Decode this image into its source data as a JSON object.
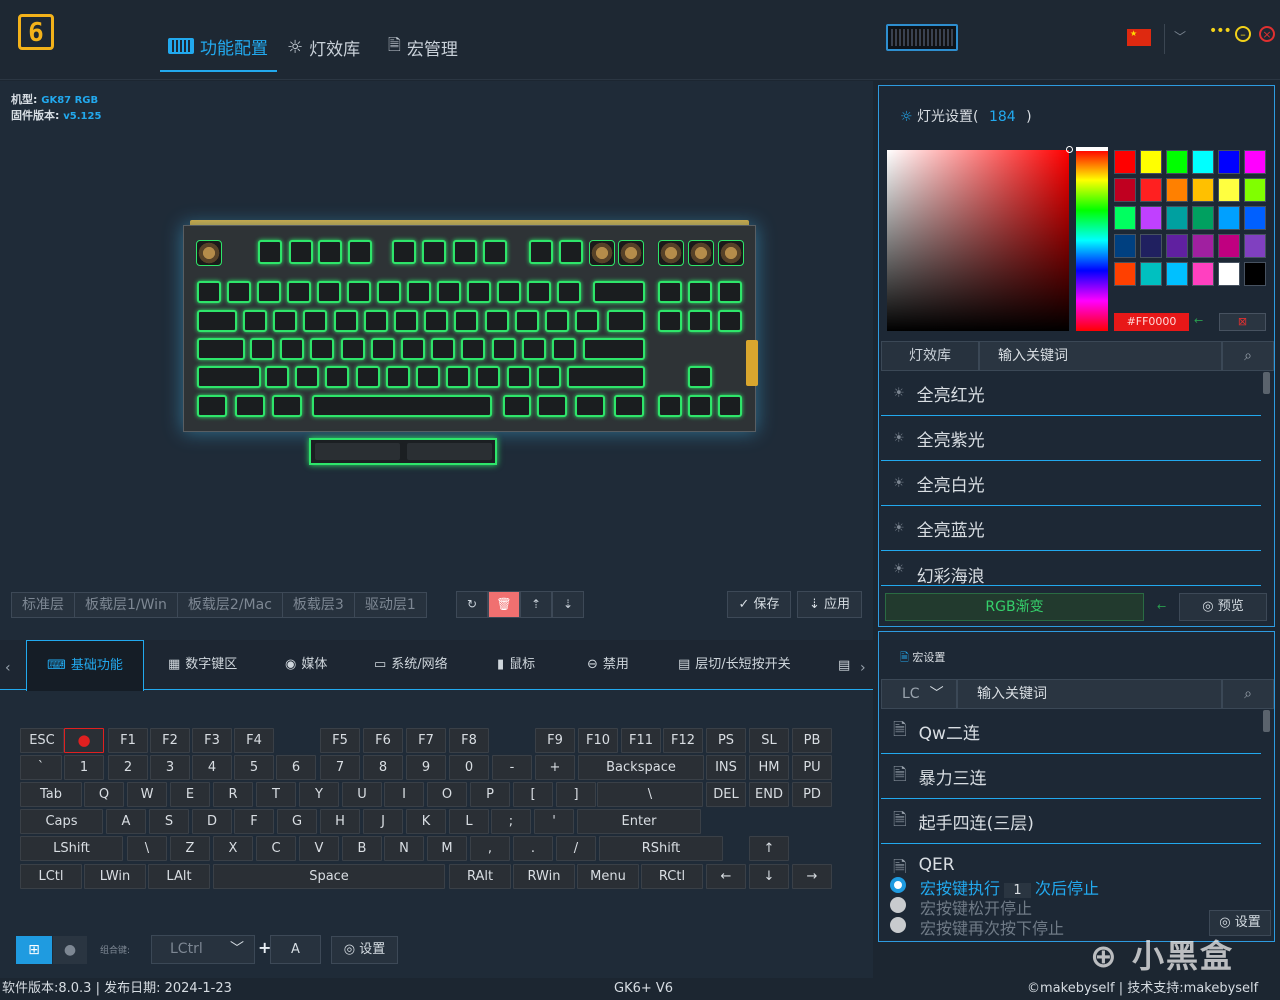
{
  "nav": {
    "tab1": "功能配置",
    "tab2": "灯效库",
    "tab3": "宏管理"
  },
  "device": {
    "model_label": "机型:",
    "model_value": "GK87 RGB",
    "firmware_label": "固件版本:",
    "firmware_value": "v5.125"
  },
  "layers": [
    "标准层",
    "板载层1/Win",
    "板载层2/Mac",
    "板载层3",
    "驱动层1"
  ],
  "actions": {
    "save": "保存",
    "apply": "应用"
  },
  "func_tabs": [
    "基础功能",
    "数字键区",
    "媒体",
    "系统/网络",
    "鼠标",
    "禁用",
    "层切/长短按开关"
  ],
  "vkb": {
    "row0": [
      "ESC",
      "●",
      "F1",
      "F2",
      "F3",
      "F4",
      "F5",
      "F6",
      "F7",
      "F8",
      "F9",
      "F10",
      "F11",
      "F12",
      "PS",
      "SL",
      "PB"
    ],
    "row1": [
      "`",
      "1",
      "2",
      "3",
      "4",
      "5",
      "6",
      "7",
      "8",
      "9",
      "0",
      "-",
      "+",
      "Backspace",
      "INS",
      "HM",
      "PU"
    ],
    "row2": [
      "Tab",
      "Q",
      "W",
      "E",
      "R",
      "T",
      "Y",
      "U",
      "I",
      "O",
      "P",
      "[",
      "]",
      "\\",
      "DEL",
      "END",
      "PD"
    ],
    "row3": [
      "Caps",
      "A",
      "S",
      "D",
      "F",
      "G",
      "H",
      "J",
      "K",
      "L",
      ";",
      "'",
      "Enter"
    ],
    "row4": [
      "LShift",
      "\\",
      "Z",
      "X",
      "C",
      "V",
      "B",
      "N",
      "M",
      ",",
      ".",
      "/",
      "RShift",
      "↑"
    ],
    "row5": [
      "LCtl",
      "LWin",
      "LAlt",
      "Space",
      "RAlt",
      "RWin",
      "Menu",
      "RCtl",
      "←",
      "↓",
      "→"
    ]
  },
  "combo": {
    "label": "组合键:",
    "modifier": "LCtrl",
    "plus": "+",
    "key": "A",
    "settings": "设置"
  },
  "lighting": {
    "title": "灯光设置(",
    "count": "184",
    "close_paren": ")",
    "hex": "#FF0000",
    "tab_label": "灯效库",
    "search_placeholder": "输入关键词",
    "effects": [
      "全亮红光",
      "全亮紫光",
      "全亮白光",
      "全亮蓝光",
      "幻彩海浪"
    ],
    "selected_effect": "RGB渐变",
    "preview": "预览"
  },
  "swatches": [
    "#ff0000",
    "#ffff00",
    "#00ff00",
    "#00ffff",
    "#0000ff",
    "#ff00ff",
    "#c00020",
    "#ff2020",
    "#ff8000",
    "#ffc000",
    "#ffff40",
    "#80ff00",
    "#00ff60",
    "#c040ff",
    "#00a0a0",
    "#00a060",
    "#00a0ff",
    "#0060ff",
    "#004080",
    "#202060",
    "#6020a0",
    "#a020a0",
    "#c00080",
    "#8040c0",
    "#ff4000",
    "#00c0c0",
    "#00c0ff",
    "#ff40c0",
    "#ffffff",
    "#000000"
  ],
  "macro": {
    "title": "宏设置",
    "filter": "LC",
    "search_placeholder": "输入关键词",
    "items": [
      "Qw二连",
      "暴力三连",
      "起手四连(三层)",
      "QER"
    ],
    "options": [
      "宏按键执行",
      "次后停止",
      "宏按键松开停止",
      "宏按键再次按下停止"
    ],
    "repeat": "1",
    "settings": "设置"
  },
  "footer": {
    "version": "软件版本:8.0.3 | 发布日期: 2024-1-23",
    "center": "GK6+ V6",
    "right": "©makebyself | 技术支持:makebyself",
    "watermark": "小黑盒"
  },
  "colors": {
    "accent": "#22a9ee",
    "glow": "#2ee56a",
    "bg": "#1c2631",
    "record": "#e02020"
  }
}
